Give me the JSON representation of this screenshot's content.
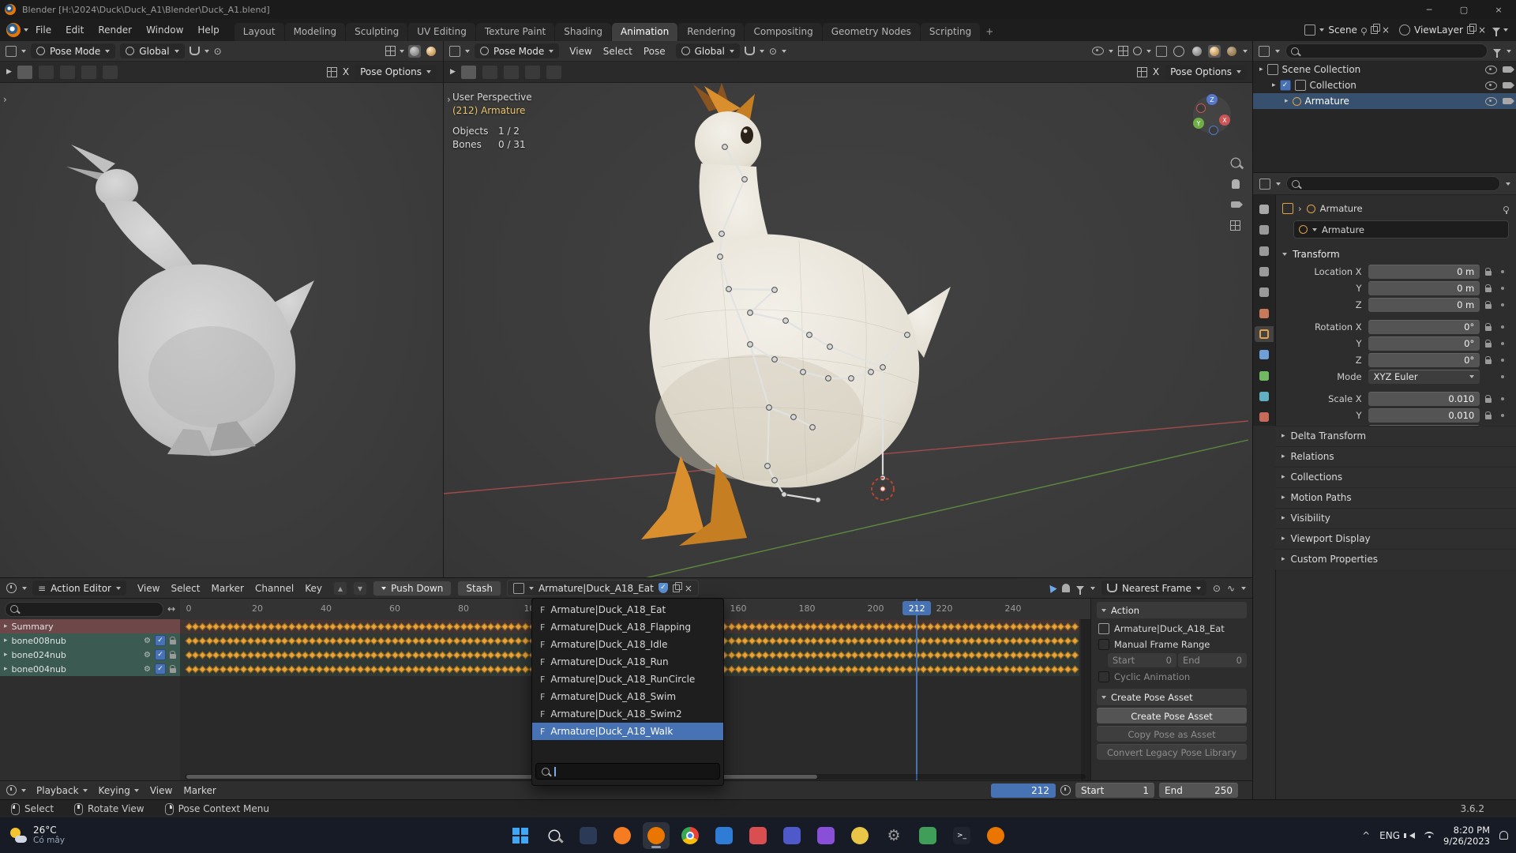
{
  "icons": {
    "gear": "⚙",
    "close": "×",
    "check": "✓",
    "arrow-right": "▸",
    "play": "▶",
    "double-arrow": "↔",
    "prop-circle": "⊙",
    "wave": "∿",
    "menu": "≡",
    "chevron-small": "›",
    "caret-up": "^",
    "dash": "─",
    "box": "▢",
    "up": "▴",
    "down": "▾"
  },
  "colors": {
    "accent": "#4772b3",
    "keyframe": "#e8a33d",
    "summary-row": "#6e4848",
    "bone-row": "#3a5a52"
  },
  "window": {
    "title": "Blender [H:\\2024\\Duck\\Duck_A1\\Blender\\Duck_A1.blend]"
  },
  "topbar": {
    "menus": [
      "File",
      "Edit",
      "Render",
      "Window",
      "Help"
    ],
    "tabs": [
      "Layout",
      "Modeling",
      "Sculpting",
      "UV Editing",
      "Texture Paint",
      "Shading",
      "Animation",
      "Rendering",
      "Compositing",
      "Geometry Nodes",
      "Scripting"
    ],
    "active_tab": "Animation",
    "add_tab": "+",
    "scene_label": "Scene",
    "view_layer_label": "ViewLayer"
  },
  "viewport_left": {
    "mode": "Pose Mode",
    "orientation": "Global",
    "pose_options": "Pose Options",
    "mirror_x": "X"
  },
  "viewport_right": {
    "mode": "Pose Mode",
    "menus": [
      "View",
      "Select",
      "Pose"
    ],
    "orientation": "Global",
    "pose_options": "Pose Options",
    "mirror_x": "X",
    "overlay": {
      "perspective": "User Perspective",
      "active_object": "(212) Armature",
      "stats": [
        [
          "Objects",
          "1 / 2"
        ],
        [
          "Bones",
          "0 / 31"
        ]
      ]
    },
    "gizmo_axes": [
      "X",
      "Y",
      "Z"
    ]
  },
  "outliner": {
    "rows": [
      {
        "label": "Scene Collection",
        "depth": 0,
        "icon": "scene-collection",
        "selected": false,
        "checkbox": false
      },
      {
        "label": "Collection",
        "depth": 1,
        "icon": "collection",
        "selected": false,
        "checkbox": true
      },
      {
        "label": "Armature",
        "depth": 2,
        "icon": "armature",
        "selected": true,
        "checkbox": false
      }
    ]
  },
  "properties": {
    "breadcrumb": "Armature",
    "name_field": "Armature",
    "tabs": [
      {
        "name": "tool",
        "color": "#a8a8a8",
        "active": false
      },
      {
        "name": "render",
        "color": "#9a9a9a",
        "active": false
      },
      {
        "name": "output",
        "color": "#9a9a9a",
        "active": false
      },
      {
        "name": "view-layer",
        "color": "#9a9a9a",
        "active": false
      },
      {
        "name": "scene",
        "color": "#9a9a9a",
        "active": false
      },
      {
        "name": "world",
        "color": "#c8795a",
        "active": false
      },
      {
        "name": "object",
        "color": "#e0a14a",
        "active": true
      },
      {
        "name": "modifiers",
        "color": "#6f9fd8",
        "active": false
      },
      {
        "name": "data",
        "color": "#72b862",
        "active": false
      },
      {
        "name": "physics",
        "color": "#62aec2",
        "active": false
      },
      {
        "name": "texture",
        "color": "#c86a5a",
        "active": false
      }
    ],
    "transform": {
      "title": "Transform",
      "rows": [
        {
          "label": "Location X",
          "value": "0 m",
          "lock": true,
          "gap": false,
          "drop": false
        },
        {
          "label": "Y",
          "value": "0 m",
          "lock": true,
          "gap": false,
          "drop": false
        },
        {
          "label": "Z",
          "value": "0 m",
          "lock": true,
          "gap": false,
          "drop": false
        },
        {
          "label": "Rotation X",
          "value": "0°",
          "lock": true,
          "gap": true,
          "drop": false
        },
        {
          "label": "Y",
          "value": "0°",
          "lock": true,
          "gap": false,
          "drop": false
        },
        {
          "label": "Z",
          "value": "0°",
          "lock": true,
          "gap": false,
          "drop": false
        },
        {
          "label": "Mode",
          "value": "XYZ Euler",
          "lock": false,
          "gap": false,
          "drop": true
        },
        {
          "label": "Scale X",
          "value": "0.010",
          "lock": true,
          "gap": true,
          "drop": false
        },
        {
          "label": "Y",
          "value": "0.010",
          "lock": true,
          "gap": false,
          "drop": false
        },
        {
          "label": "Z",
          "value": "0.010",
          "lock": true,
          "gap": false,
          "drop": false
        }
      ]
    },
    "collapsed_panels": [
      "Delta Transform",
      "Relations",
      "Collections",
      "Motion Paths",
      "Visibility",
      "Viewport Display",
      "Custom Properties"
    ]
  },
  "dope_sheet": {
    "editor_label": "Action Editor",
    "menus": [
      "View",
      "Select",
      "Marker",
      "Channel",
      "Key"
    ],
    "push_down": "Push Down",
    "stash": "Stash",
    "action_name": "Armature|Duck_A18_Eat",
    "snap_label": "Nearest Frame",
    "channels": [
      {
        "name": "Summary",
        "type": "summary"
      },
      {
        "name": "bone008nub",
        "type": "bone"
      },
      {
        "name": "bone024nub",
        "type": "bone"
      },
      {
        "name": "bone004nub",
        "type": "bone"
      }
    ],
    "ruler": {
      "start": 0,
      "end": 240,
      "step": 20
    },
    "keys": {
      "start": 0,
      "end": 258,
      "step": 2
    },
    "current_frame": 212
  },
  "action_dropdown": {
    "prefix": "F",
    "items": [
      "Armature|Duck_A18_Eat",
      "Armature|Duck_A18_Flapping",
      "Armature|Duck_A18_Idle",
      "Armature|Duck_A18_Run",
      "Armature|Duck_A18_RunCircle",
      "Armature|Duck_A18_Swim",
      "Armature|Duck_A18_Swim2",
      "Armature|Duck_A18_Walk"
    ],
    "selected": "Armature|Duck_A18_Walk",
    "search_value": ""
  },
  "action_panel": {
    "title": "Action",
    "action_name": "Armature|Duck_A18_Eat",
    "manual_frame_range": "Manual Frame Range",
    "start_label": "Start",
    "start_value": "0",
    "end_label": "End",
    "end_value": "0",
    "cyclic": "Cyclic Animation",
    "create_title": "Create Pose Asset",
    "buttons": [
      {
        "label": "Create Pose Asset",
        "enabled": true
      },
      {
        "label": "Copy Pose as Asset",
        "enabled": false
      },
      {
        "label": "Convert Legacy Pose Library",
        "enabled": false
      }
    ]
  },
  "timeline": {
    "menus": [
      {
        "label": "Playback",
        "dropdown": true
      },
      {
        "label": "Keying",
        "dropdown": true
      },
      {
        "label": "View",
        "dropdown": false
      },
      {
        "label": "Marker",
        "dropdown": false
      }
    ],
    "frame": "212",
    "start_label": "Start",
    "start_value": "1",
    "end_label": "End",
    "end_value": "250"
  },
  "status_bar": {
    "hints": [
      {
        "button": "left",
        "label": "Select"
      },
      {
        "button": "middle",
        "label": "Rotate View"
      },
      {
        "button": "right",
        "label": "Pose Context Menu"
      }
    ],
    "version": "3.6.2"
  },
  "taskbar": {
    "weather_temp": "26°C",
    "weather_desc": "Có mây",
    "icons": [
      {
        "name": "start",
        "shape": "win",
        "color": "#3fa7f5",
        "active": false
      },
      {
        "name": "search",
        "shape": "mag",
        "color": "#e8e8e8",
        "active": false
      },
      {
        "name": "task-view",
        "shape": "square",
        "color": "#2b3a55",
        "active": false
      },
      {
        "name": "firefox",
        "shape": "circle",
        "color": "#f57c20",
        "active": false
      },
      {
        "name": "blender",
        "shape": "circle",
        "color": "#ea7600",
        "active": true
      },
      {
        "name": "chrome",
        "shape": "chrome",
        "color": "#4285f4",
        "active": false
      },
      {
        "name": "mail",
        "shape": "square",
        "color": "#2f7cd6",
        "active": false
      },
      {
        "name": "store",
        "shape": "square",
        "color": "#d94f4f",
        "active": false
      },
      {
        "name": "teams",
        "shape": "square",
        "color": "#5059c9",
        "active": false
      },
      {
        "name": "media-app",
        "shape": "square",
        "color": "#8a4fd9",
        "active": false
      },
      {
        "name": "browser-2",
        "shape": "circle",
        "color": "#e8c547",
        "active": false
      },
      {
        "name": "settings",
        "shape": "gear",
        "color": "#9a9a9a",
        "active": false
      },
      {
        "name": "sheets",
        "shape": "square",
        "color": "#3f9e57",
        "active": false
      },
      {
        "name": "terminal",
        "shape": "terminal",
        "color": "#1f242e",
        "active": false
      },
      {
        "name": "blender-2",
        "shape": "circle",
        "color": "#ea7600",
        "active": false
      }
    ],
    "tray_lang": "ENG",
    "time": "8:20 PM",
    "date": "9/26/2023"
  }
}
